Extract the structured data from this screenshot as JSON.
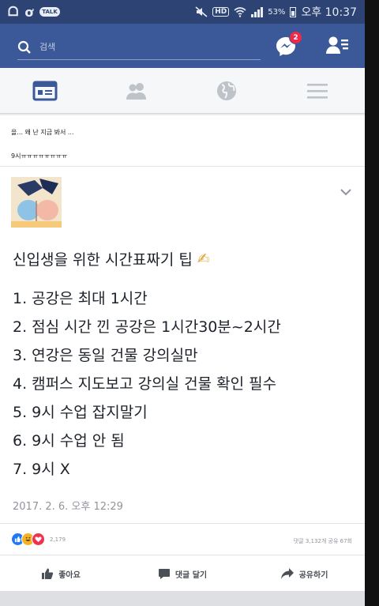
{
  "statusbar": {
    "battery": "53%",
    "time": "오후 10:37",
    "talk_label": "TALK",
    "hd_label": "HD"
  },
  "header": {
    "search_placeholder": "검색",
    "messenger_badge": "2"
  },
  "tabs": [
    {
      "name": "news-feed",
      "active": true
    },
    {
      "name": "friends",
      "active": false
    },
    {
      "name": "notifications-globe",
      "active": false
    },
    {
      "name": "menu",
      "active": false
    }
  ],
  "post": {
    "previous_lines": [
      "을... 왜 난 지금 봐서 ...",
      "9시ㅠㅠㅠㅠㅠㅠㅠㅠ"
    ],
    "title": "신입생을 위한 시간표짜기 팁",
    "title_emoji": "✍",
    "tips": [
      "1. 공강은 최대 1시간",
      "2. 점심 시간 낀 공강은 1시간30분~2시간",
      "3. 연강은 동일 건물 강의실만",
      "4. 캠퍼스 지도보고 강의실 건물 확인 필수",
      "5. 9시 수업 잡지말기",
      "6. 9시 수업 안 됨",
      "7. 9시 X"
    ],
    "timestamp": "2017. 2. 6. 오후 12:29",
    "reaction_count": "2,179",
    "stats": "댓글 3,132개  공유 67회"
  },
  "actions": {
    "like": "좋아요",
    "comment": "댓글 달기",
    "share": "공유하기"
  },
  "colors": {
    "facebook_blue": "#3b5998",
    "status_bar": "#2d4373",
    "like_blue": "#2078f4",
    "haha_yellow": "#f7b125",
    "love_red": "#f0324e"
  }
}
